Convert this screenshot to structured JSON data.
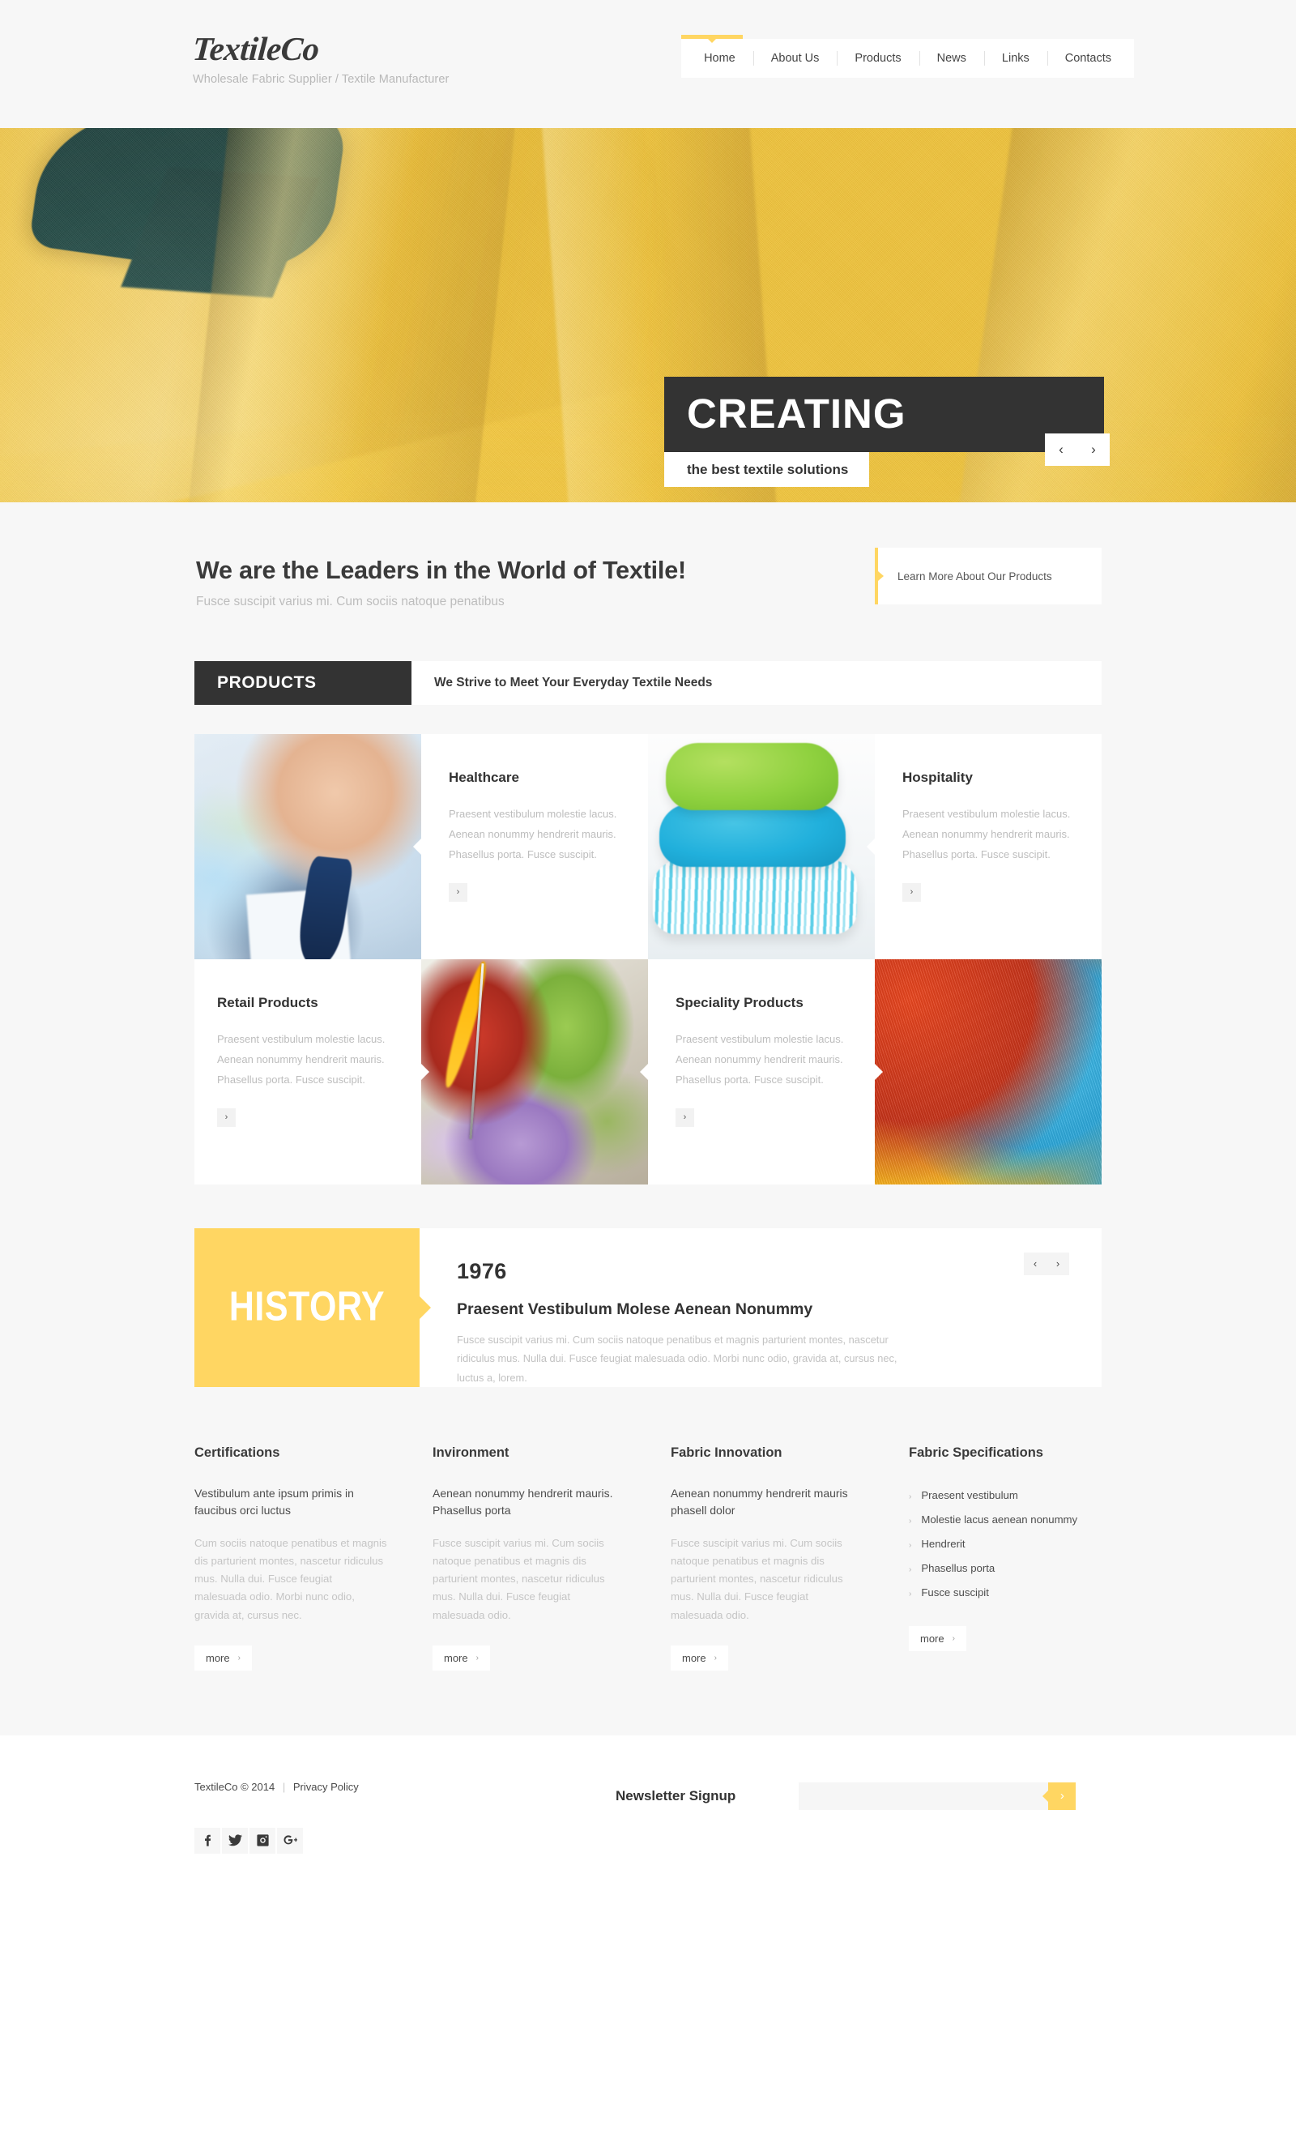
{
  "header": {
    "logo": "TextileCo",
    "tagline": "Wholesale Fabric Supplier / Textile Manufacturer",
    "nav": [
      {
        "label": "Home",
        "active": true
      },
      {
        "label": "About Us",
        "active": false
      },
      {
        "label": "Products",
        "active": false
      },
      {
        "label": "News",
        "active": false
      },
      {
        "label": "Links",
        "active": false
      },
      {
        "label": "Contacts",
        "active": false
      }
    ]
  },
  "hero": {
    "caption_main": "CREATING",
    "caption_sub": "the best textile solutions",
    "prev_icon": "‹",
    "next_icon": "›"
  },
  "leaders": {
    "title": "We are the Leaders in the World of Textile!",
    "subtitle": "Fusce suscipit varius mi. Cum sociis natoque penatibus",
    "cta": "Learn More About Our Products"
  },
  "products": {
    "tab_label": "PRODUCTS",
    "tagline": "We Strive to Meet Your Everyday Textile Needs",
    "button_icon": "›",
    "items": [
      {
        "title": "Healthcare",
        "desc": "Praesent vestibulum molestie lacus. Aenean nonummy hendrerit mauris. Phasellus porta. Fusce suscipit.",
        "image": "healthcare-doctor-photo"
      },
      {
        "title": "Hospitality",
        "desc": "Praesent vestibulum molestie lacus. Aenean nonummy hendrerit mauris. Phasellus porta. Fusce suscipit.",
        "image": "hospitality-pillows-photo"
      },
      {
        "title": "Retail Products",
        "desc": "Praesent vestibulum molestie lacus. Aenean nonummy hendrerit mauris. Phasellus porta. Fusce suscipit.",
        "image": "retail-yarn-needle-photo"
      },
      {
        "title": "Speciality Products",
        "desc": "Praesent vestibulum molestie lacus. Aenean nonummy hendrerit mauris. Phasellus porta. Fusce suscipit.",
        "image": "speciality-yarn-balls-photo"
      }
    ]
  },
  "history": {
    "label": "HISTORY",
    "year": "1976",
    "heading": "Praesent Vestibulum Molese Aenean Nonummy",
    "body": "Fusce suscipit varius mi. Cum sociis natoque penatibus et magnis parturient montes, nascetur ridiculus mus. Nulla dui. Fusce feugiat malesuada odio. Morbi nunc odio, gravida at, cursus nec, luctus a, lorem.",
    "prev_icon": "‹",
    "next_icon": "›"
  },
  "info_columns": [
    {
      "title": "Certifications",
      "lead": "Vestibulum ante ipsum primis in faucibus orci luctus",
      "body": "Cum sociis natoque penatibus et magnis dis parturient montes, nascetur ridiculus mus. Nulla dui. Fusce feugiat malesuada odio. Morbi nunc odio, gravida at, cursus nec.",
      "more_label": "more",
      "more_icon": "›"
    },
    {
      "title": "Invironment",
      "lead": "Aenean nonummy hendrerit mauris. Phasellus porta",
      "body": "Fusce suscipit varius mi. Cum sociis natoque penatibus et magnis dis parturient montes, nascetur ridiculus mus. Nulla dui. Fusce feugiat malesuada odio.",
      "more_label": "more",
      "more_icon": "›"
    },
    {
      "title": "Fabric Innovation",
      "lead": "Aenean nonummy hendrerit mauris phasell dolor",
      "body": "Fusce suscipit varius mi. Cum sociis natoque penatibus et magnis dis parturient montes, nascetur ridiculus mus. Nulla dui. Fusce feugiat malesuada odio.",
      "more_label": "more",
      "more_icon": "›"
    }
  ],
  "specifications": {
    "title": "Fabric Specifications",
    "items": [
      "Praesent vestibulum",
      "Molestie lacus aenean nonummy",
      "Hendrerit",
      "Phasellus porta",
      "Fusce suscipit"
    ],
    "bullet_icon": "›",
    "more_label": "more",
    "more_icon": "›"
  },
  "footer": {
    "copyright": "TextileCo © 2014",
    "separator": "|",
    "privacy": "Privacy Policy",
    "newsletter_label": "Newsletter Signup",
    "newsletter_placeholder": "",
    "newsletter_value": "",
    "newsletter_button_icon": "›",
    "socials": [
      {
        "name": "facebook-icon"
      },
      {
        "name": "twitter-icon"
      },
      {
        "name": "instagram-icon"
      },
      {
        "name": "googleplus-icon"
      }
    ]
  },
  "colors": {
    "accent_yellow": "#ffd662",
    "dark": "#333333",
    "page_bg": "#f7f7f7",
    "muted_text": "#bdbdbd"
  }
}
